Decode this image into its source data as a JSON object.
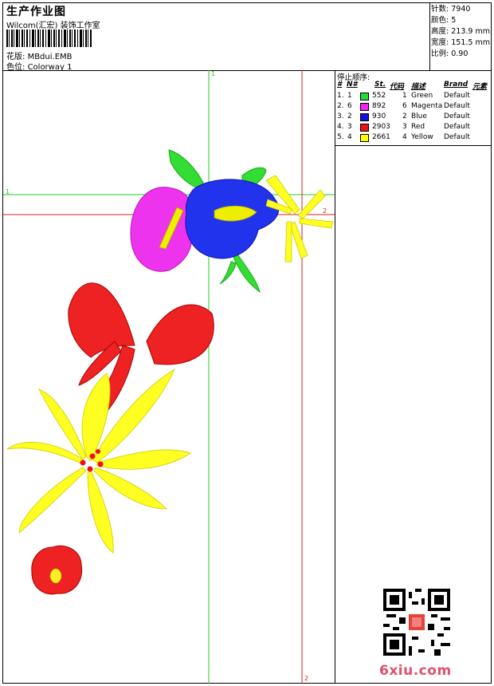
{
  "header": {
    "title": "生产作业图",
    "company": "Wilcom(汇宏) 装饰工作室",
    "design_label": "花版:",
    "design_value": "MBdui.EMB",
    "colorway_label": "色位:",
    "colorway_value": "Colorway 1"
  },
  "stats": {
    "stitches_label": "针数:",
    "stitches_value": "7940",
    "colors_label": "颜色:",
    "colors_value": "5",
    "height_label": "高度:",
    "height_value": "213.9 mm",
    "width_label": "宽度:",
    "width_value": "151.5 mm",
    "scale_label": "比例:",
    "scale_value": "0.90"
  },
  "stop_sequence": {
    "title": "停止顺序:",
    "headers": [
      "#",
      "N#",
      "St.",
      "代码",
      "描述",
      "Brand",
      "元素"
    ],
    "rows": [
      {
        "idx": "1.",
        "n": "1",
        "st": "552",
        "code": "1",
        "desc": "Green",
        "brand": "Default",
        "color": "#22dd33"
      },
      {
        "idx": "2.",
        "n": "6",
        "st": "892",
        "code": "6",
        "desc": "Magenta",
        "brand": "Default",
        "color": "#ee22ee"
      },
      {
        "idx": "3.",
        "n": "2",
        "st": "930",
        "code": "2",
        "desc": "Blue",
        "brand": "Default",
        "color": "#1111dd"
      },
      {
        "idx": "4.",
        "n": "3",
        "st": "2903",
        "code": "3",
        "desc": "Red",
        "brand": "Default",
        "color": "#ee1111"
      },
      {
        "idx": "5.",
        "n": "4",
        "st": "2661",
        "code": "4",
        "desc": "Yellow",
        "brand": "Default",
        "color": "#ffff00"
      }
    ]
  },
  "guides": {
    "green_v": "1",
    "green_h": "1",
    "red_v_top": "2",
    "red_v_bottom": "2",
    "red_h": "2",
    "green_color": "#22cc22",
    "red_color": "#dd2222"
  },
  "watermark": "6xiu.com"
}
